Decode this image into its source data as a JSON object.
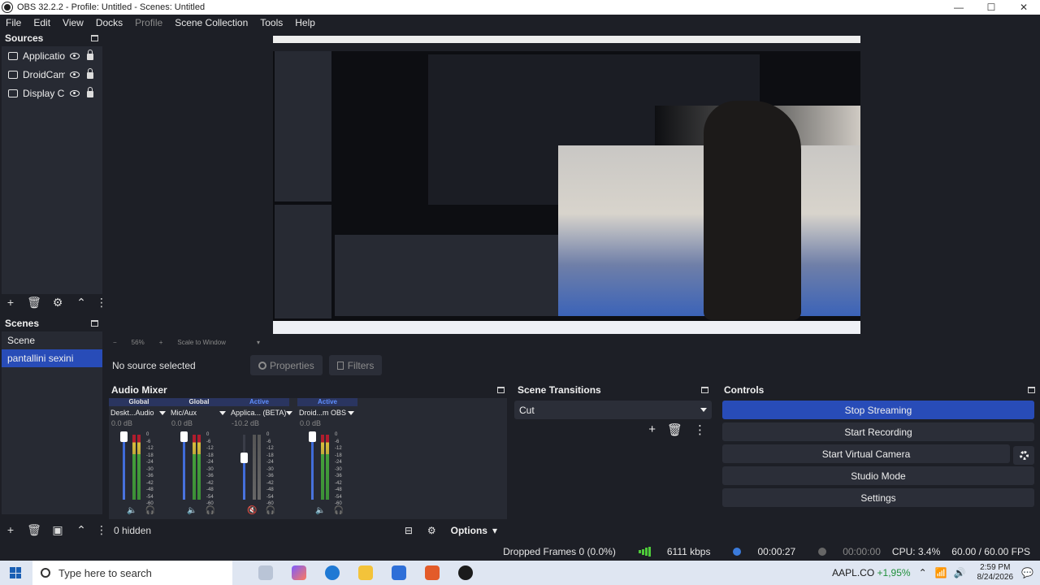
{
  "window": {
    "title": "OBS 32.2.2 - Profile: Untitled - Scenes: Untitled",
    "controls": [
      "—",
      "☐",
      "✕"
    ]
  },
  "menu": {
    "items": [
      "File",
      "Edit",
      "View",
      "Docks",
      "Profile",
      "Scene Collection",
      "Tools",
      "Help"
    ],
    "disabled": [
      "Profile"
    ]
  },
  "sources": {
    "title": "Sources",
    "items": [
      {
        "label": "Applicatio",
        "icon": "application-audio-icon"
      },
      {
        "label": "DroidCam",
        "icon": "video-capture-icon"
      },
      {
        "label": "Display C",
        "icon": "display-capture-icon"
      }
    ]
  },
  "scenes": {
    "title": "Scenes",
    "items": [
      {
        "label": "Scene",
        "selected": false
      },
      {
        "label": "pantallini sexini",
        "selected": true
      }
    ]
  },
  "preview": {
    "zoom": "56%",
    "fit": "Scale to Window"
  },
  "source_info": {
    "no_source": "No source selected",
    "properties": "Properties",
    "filters": "Filters"
  },
  "mixer": {
    "title": "Audio Mixer",
    "channels": [
      {
        "status": "Global",
        "name": "Deskt...Audio",
        "db": "0.0 dB",
        "level": 1.0
      },
      {
        "status": "Global",
        "name": "Mic/Aux",
        "db": "0.0 dB",
        "level": 1.0
      },
      {
        "status": "Active",
        "name": "Applica... (BETA)",
        "db": "-10.2 dB",
        "level": 0.62,
        "muted": true
      },
      {
        "status": "Active",
        "name": "Droid...m OBS",
        "db": "0.0 dB",
        "level": 1.0
      }
    ],
    "scale": [
      "0",
      "-6",
      "-12",
      "-18",
      "-24",
      "-30",
      "-36",
      "-42",
      "-48",
      "-54",
      "-60"
    ],
    "hidden": "0 hidden",
    "options": "Options"
  },
  "transitions": {
    "title": "Scene Transitions",
    "selected": "Cut"
  },
  "controls": {
    "title": "Controls",
    "buttons": [
      "Stop Streaming",
      "Start Recording",
      "Start Virtual Camera",
      "Studio Mode",
      "Settings"
    ]
  },
  "status": {
    "dropped": "Dropped Frames 0 (0.0%)",
    "bitrate": "6111 kbps",
    "stream_time": "00:00:27",
    "rec_time": "00:00:00",
    "cpu": "CPU: 3.4%",
    "fps": "60.00 / 60.00 FPS",
    "stream_color": "#3b7bdc"
  },
  "taskbar": {
    "search": "Type here to search",
    "stock_name": "AAPL.CO",
    "stock_change": "+1,95%",
    "time": "2:59 PM",
    "date": "8/24/2026"
  }
}
